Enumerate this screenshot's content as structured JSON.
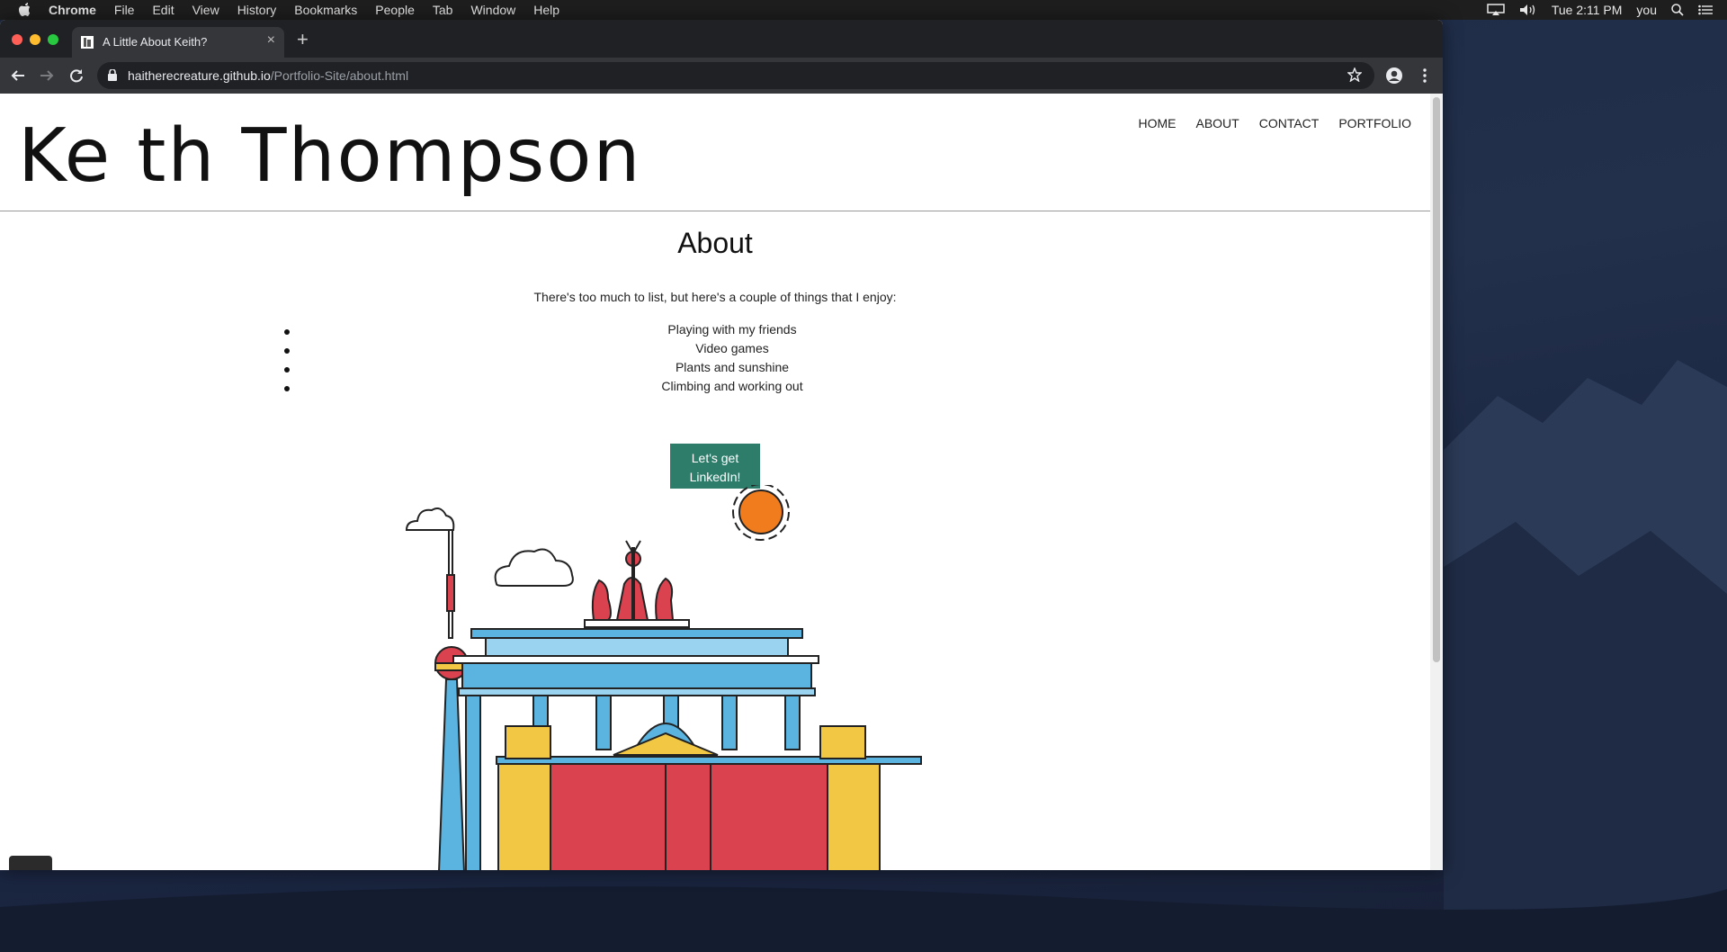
{
  "menubar": {
    "app": "Chrome",
    "items": [
      "File",
      "Edit",
      "View",
      "History",
      "Bookmarks",
      "People",
      "Tab",
      "Window",
      "Help"
    ],
    "clock": "Tue 2:11 PM",
    "user": "you"
  },
  "browser": {
    "tab_title": "A Little About Keith?",
    "url_host": "haitherecreature.github.io",
    "url_path": "/Portfolio-Site/about.html"
  },
  "site": {
    "title": "Ke th Thompson",
    "nav": [
      "HOME",
      "ABOUT",
      "CONTACT",
      "PORTFOLIO"
    ],
    "heading": "About",
    "intro": "There's too much to list, but here's a couple of things that I enjoy:",
    "likes": [
      "Playing with my friends",
      "Video games",
      "Plants and sunshine",
      "Climbing and working out"
    ],
    "cta_label": "Let's get LinkedIn!"
  },
  "colors": {
    "cta_bg": "#2e7d6b",
    "sun": "#f07c1d",
    "gate_blue": "#5bb4e0",
    "gate_red": "#d9424e",
    "gate_yellow": "#f2c744"
  }
}
